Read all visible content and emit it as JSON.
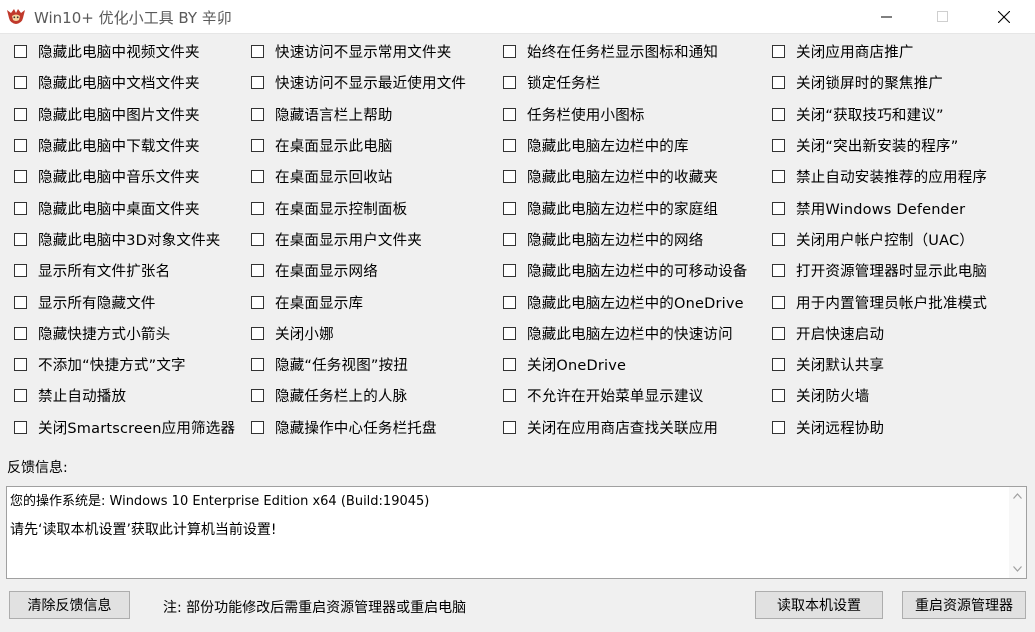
{
  "window": {
    "title": "Win10+ 优化小工具 BY 辛卯",
    "accent": "#c0392b"
  },
  "options": {
    "col0": [
      "隐藏此电脑中视频文件夹",
      "隐藏此电脑中文档文件夹",
      "隐藏此电脑中图片文件夹",
      "隐藏此电脑中下载文件夹",
      "隐藏此电脑中音乐文件夹",
      "隐藏此电脑中桌面文件夹",
      "隐藏此电脑中3D对象文件夹",
      "显示所有文件扩张名",
      "显示所有隐藏文件",
      "隐藏快捷方式小箭头",
      "不添加“快捷方式”文字",
      "禁止自动播放",
      "关闭Smartscreen应用筛选器"
    ],
    "col1": [
      "快速访问不显示常用文件夹",
      "快速访问不显示最近使用文件",
      "隐藏语言栏上帮助",
      "在桌面显示此电脑",
      "在桌面显示回收站",
      "在桌面显示控制面板",
      "在桌面显示用户文件夹",
      "在桌面显示网络",
      "在桌面显示库",
      "关闭小娜",
      "隐藏“任务视图”按扭",
      "隐藏任务栏上的人脉",
      "隐藏操作中心任务栏托盘"
    ],
    "col2": [
      "始终在任务栏显示图标和通知",
      "锁定任务栏",
      "任务栏使用小图标",
      "隐藏此电脑左边栏中的库",
      "隐藏此电脑左边栏中的收藏夹",
      "隐藏此电脑左边栏中的家庭组",
      "隐藏此电脑左边栏中的网络",
      "隐藏此电脑左边栏中的可移动设备",
      "隐藏此电脑左边栏中的OneDrive",
      "隐藏此电脑左边栏中的快速访问",
      "关闭OneDrive",
      "不允许在开始菜单显示建议",
      "关闭在应用商店查找关联应用"
    ],
    "col3": [
      "关闭应用商店推广",
      "关闭锁屏时的聚焦推广",
      "关闭“获取技巧和建议”",
      "关闭“突出新安装的程序”",
      "禁止自动安装推荐的应用程序",
      "禁用Windows Defender",
      "关闭用户帐户控制（UAC）",
      "打开资源管理器时显示此电脑",
      "用于内置管理员帐户批准模式",
      "开启快速启动",
      "关闭默认共享",
      "关闭防火墙",
      "关闭远程协助"
    ]
  },
  "feedback": {
    "label": "反馈信息:",
    "line0": "您的操作系统是: Windows 10 Enterprise Edition x64 (Build:19045)",
    "line1": "请先‘读取本机设置’获取此计算机当前设置!"
  },
  "footer": {
    "clear_label": "清除反馈信息",
    "note": "注: 部份功能修改后需重启资源管理器或重启电脑",
    "read_label": "读取本机设置",
    "restart_label": "重启资源管理器"
  }
}
